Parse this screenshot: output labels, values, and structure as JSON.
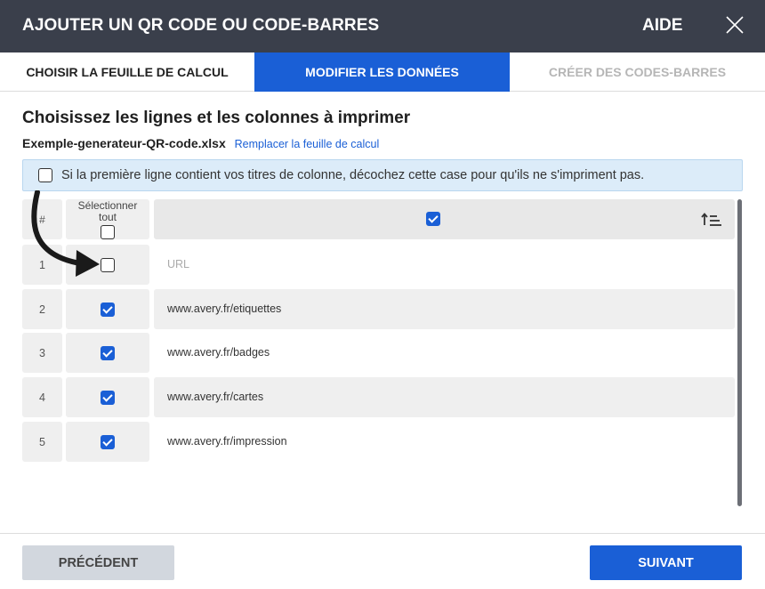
{
  "header": {
    "title": "AJOUTER UN QR CODE OU CODE-BARRES",
    "help_label": "AIDE",
    "close_icon": "close-icon"
  },
  "tabs": [
    {
      "label": "CHOISIR LA FEUILLE DE CALCUL",
      "state": "inactive"
    },
    {
      "label": "MODIFIER LES DONNÉES",
      "state": "active"
    },
    {
      "label": "CRÉER DES CODES-BARRES",
      "state": "disabled"
    }
  ],
  "main": {
    "section_title": "Choisissez les lignes et les colonnes à imprimer",
    "file_name": "Exemple-generateur-QR-code.xlsx",
    "replace_link": "Remplacer la feuille de calcul",
    "header_row_notice": "Si la première ligne contient vos titres de colonne, décochez cette case pour qu'ils ne s'impriment pas.",
    "header_row_checked": false
  },
  "table": {
    "hash_label": "#",
    "select_all_label_1": "Sélectionner",
    "select_all_label_2": "tout",
    "select_all_checked": false,
    "column_checked": true,
    "rows": [
      {
        "num": "1",
        "checked": false,
        "value": "URL"
      },
      {
        "num": "2",
        "checked": true,
        "value": "www.avery.fr/etiquettes"
      },
      {
        "num": "3",
        "checked": true,
        "value": "www.avery.fr/badges"
      },
      {
        "num": "4",
        "checked": true,
        "value": "www.avery.fr/cartes"
      },
      {
        "num": "5",
        "checked": true,
        "value": "www.avery.fr/impression"
      }
    ]
  },
  "footer": {
    "prev_label": "PRÉCÉDENT",
    "next_label": "SUIVANT"
  },
  "colors": {
    "header_bg": "#3a3f4b",
    "accent_blue": "#1a5fd6",
    "info_bg": "#dcecf9"
  }
}
